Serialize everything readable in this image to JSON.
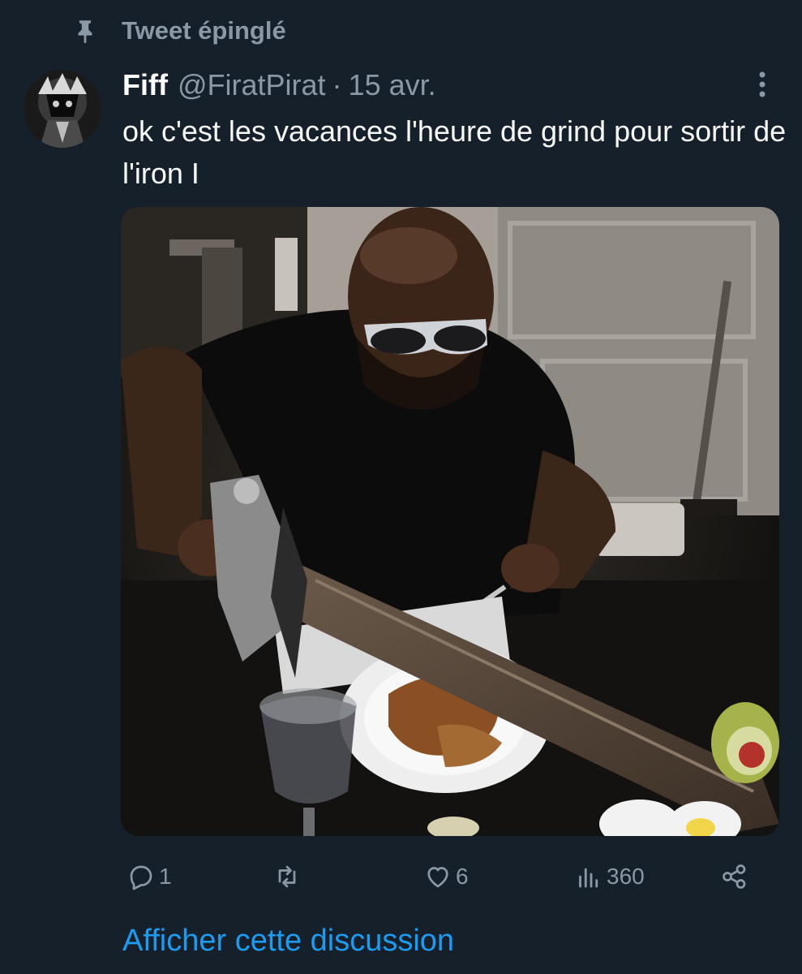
{
  "pinned": {
    "label": "Tweet épinglé",
    "icon": "pin-icon"
  },
  "tweet": {
    "display_name": "Fiff",
    "handle": "@FiratPirat",
    "separator": "·",
    "date": "15 avr.",
    "text": "ok c'est les vacances l'heure de grind pour sortir de l'iron I",
    "media_alt": "photo: man in sunglasses eating at a table while holding a sword"
  },
  "actions": {
    "reply": {
      "icon": "reply-icon",
      "count": "1"
    },
    "retweet": {
      "icon": "retweet-icon",
      "count": ""
    },
    "like": {
      "icon": "heart-icon",
      "count": "6"
    },
    "views": {
      "icon": "views-icon",
      "count": "360"
    },
    "share": {
      "icon": "share-icon"
    }
  },
  "discussion_link": "Afficher cette discussion",
  "colors": {
    "background": "#15202b",
    "secondary_text": "#8b98a5",
    "link": "#1d9bf0"
  }
}
